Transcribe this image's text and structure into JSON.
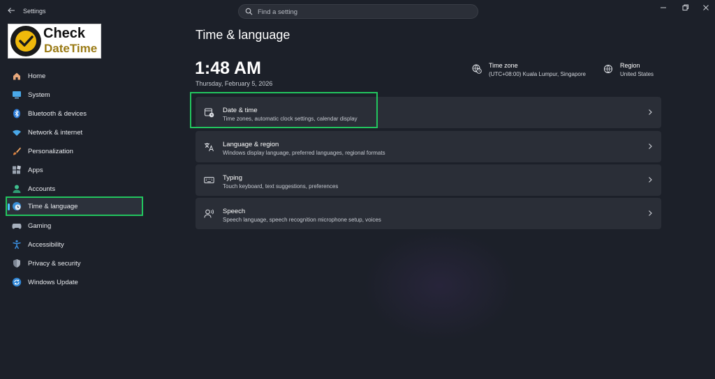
{
  "window": {
    "title": "Settings"
  },
  "search": {
    "placeholder": "Find a setting"
  },
  "logo": {
    "line1": "Check",
    "line2": "DateTime"
  },
  "sidebar": {
    "items": [
      {
        "label": "Home",
        "icon": "home-icon"
      },
      {
        "label": "System",
        "icon": "monitor-icon"
      },
      {
        "label": "Bluetooth & devices",
        "icon": "bluetooth-icon"
      },
      {
        "label": "Network & internet",
        "icon": "wifi-icon"
      },
      {
        "label": "Personalization",
        "icon": "brush-icon"
      },
      {
        "label": "Apps",
        "icon": "apps-icon"
      },
      {
        "label": "Accounts",
        "icon": "person-icon"
      },
      {
        "label": "Time & language",
        "icon": "globe-clock-icon",
        "active": true
      },
      {
        "label": "Gaming",
        "icon": "controller-icon"
      },
      {
        "label": "Accessibility",
        "icon": "accessibility-icon"
      },
      {
        "label": "Privacy & security",
        "icon": "shield-icon"
      },
      {
        "label": "Windows Update",
        "icon": "update-icon"
      }
    ]
  },
  "main": {
    "title": "Time & language",
    "time": "1:48 AM",
    "date": "Thursday, February 5, 2026",
    "timezone": {
      "title": "Time zone",
      "value": "(UTC+08:00) Kuala Lumpur, Singapore"
    },
    "region": {
      "title": "Region",
      "value": "United States"
    },
    "cards": [
      {
        "title": "Date & time",
        "subtitle": "Time zones, automatic clock settings, calendar display",
        "icon": "calendar-clock-icon"
      },
      {
        "title": "Language & region",
        "subtitle": "Windows display language, preferred languages, regional formats",
        "icon": "language-icon"
      },
      {
        "title": "Typing",
        "subtitle": "Touch keyboard, text suggestions, preferences",
        "icon": "keyboard-icon"
      },
      {
        "title": "Speech",
        "subtitle": "Speech language, speech recognition microphone setup, voices",
        "icon": "speech-icon"
      }
    ]
  },
  "colors": {
    "background": "#1c2029",
    "card": "#2a2e37",
    "highlight": "#22c55e",
    "accent": "#4cc2ff"
  }
}
